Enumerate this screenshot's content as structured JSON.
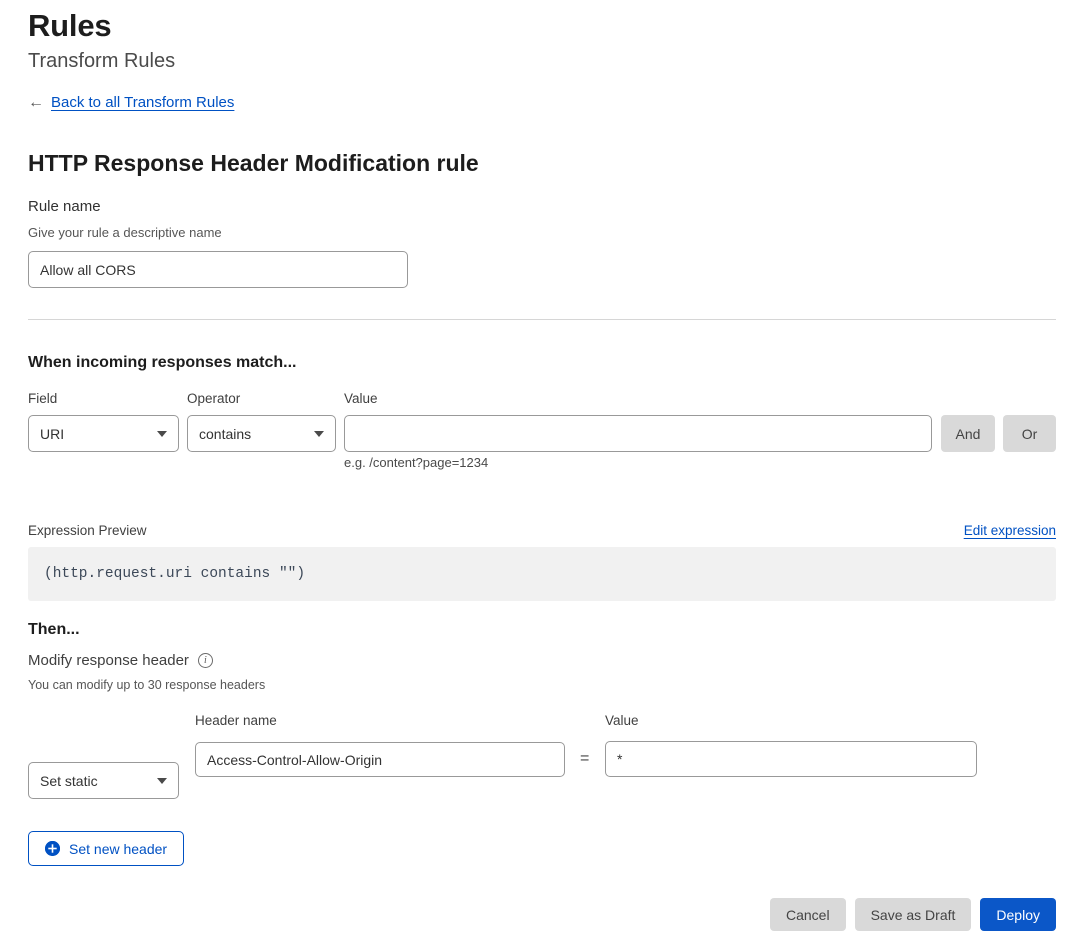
{
  "header": {
    "title": "Rules",
    "subtitle": "Transform Rules",
    "back_link": "Back to all Transform Rules",
    "back_arrow_icon": "arrow-left-icon",
    "rule_heading": "HTTP Response Header Modification rule"
  },
  "rule_name": {
    "label": "Rule name",
    "help": "Give your rule a descriptive name",
    "value": "Allow all CORS",
    "placeholder": ""
  },
  "match": {
    "heading": "When incoming responses match...",
    "field_label": "Field",
    "field_value": "URI",
    "operator_label": "Operator",
    "operator_value": "contains",
    "value_label": "Value",
    "value_value": "",
    "value_placeholder": "",
    "value_hint": "e.g. /content?page=1234",
    "and_label": "And",
    "or_label": "Or"
  },
  "expression": {
    "label": "Expression Preview",
    "edit_link": "Edit expression",
    "text": "(http.request.uri contains \"\")"
  },
  "then": {
    "heading": "Then...",
    "action_label": "Modify response header",
    "info_icon": "info-circle-icon",
    "info_glyph": "i",
    "help": "You can modify up to 30 response headers"
  },
  "header_row": {
    "mode_value": "Set static",
    "header_name_label": "Header name",
    "header_name_value": "Access-Control-Allow-Origin",
    "header_name_placeholder": "",
    "equals": "=",
    "value_label": "Value",
    "value_value": "*",
    "value_placeholder": ""
  },
  "set_new_header": {
    "label": "Set new header",
    "icon": "plus-circle-icon"
  },
  "footer": {
    "cancel_label": "Cancel",
    "save_draft_label": "Save as Draft",
    "deploy_label": "Deploy"
  },
  "colors": {
    "link": "#0051c3",
    "primary": "#0b57c8",
    "grey_button": "#d9d9d9",
    "expression_bg": "#f1f1f1"
  }
}
